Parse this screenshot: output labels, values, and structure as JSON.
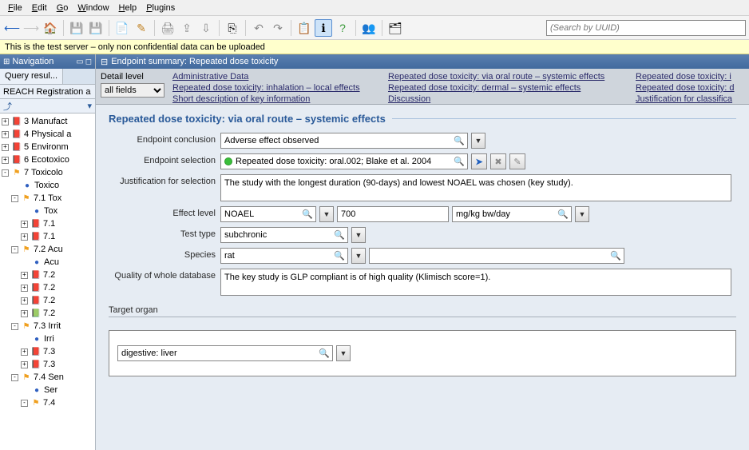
{
  "menubar": [
    {
      "label": "File",
      "ul": "F"
    },
    {
      "label": "Edit",
      "ul": "E"
    },
    {
      "label": "Go",
      "ul": "G"
    },
    {
      "label": "Window",
      "ul": "W"
    },
    {
      "label": "Help",
      "ul": "H"
    },
    {
      "label": "Plugins",
      "ul": "P"
    }
  ],
  "toolbar": {
    "search_placeholder": "(Search by UUID)"
  },
  "banner": "This is the test server – only non confidential data can be uploaded",
  "nav": {
    "title": "Navigation",
    "query_tab": "Query resul...",
    "reach_label": "REACH Registration a",
    "tree": [
      {
        "exp": "+",
        "pad": 0,
        "icon": "book",
        "label": "3 Manufact"
      },
      {
        "exp": "+",
        "pad": 0,
        "icon": "book",
        "label": "4 Physical a"
      },
      {
        "exp": "+",
        "pad": 0,
        "icon": "book",
        "label": "5 Environm"
      },
      {
        "exp": "+",
        "pad": 0,
        "icon": "book",
        "label": "6 Ecotoxico"
      },
      {
        "exp": "-",
        "pad": 0,
        "icon": "flag",
        "label": "7 Toxicolo"
      },
      {
        "exp": "",
        "pad": 1,
        "icon": "ball",
        "label": "Toxico"
      },
      {
        "exp": "-",
        "pad": 1,
        "icon": "flag",
        "label": "7.1 Tox"
      },
      {
        "exp": "",
        "pad": 2,
        "icon": "ball",
        "label": "Tox"
      },
      {
        "exp": "+",
        "pad": 2,
        "icon": "book",
        "label": "7.1"
      },
      {
        "exp": "+",
        "pad": 2,
        "icon": "book",
        "label": "7.1"
      },
      {
        "exp": "-",
        "pad": 1,
        "icon": "flag",
        "label": "7.2 Acu"
      },
      {
        "exp": "",
        "pad": 2,
        "icon": "ball",
        "label": "Acu"
      },
      {
        "exp": "+",
        "pad": 2,
        "icon": "book",
        "label": "7.2"
      },
      {
        "exp": "+",
        "pad": 2,
        "icon": "book",
        "label": "7.2"
      },
      {
        "exp": "+",
        "pad": 2,
        "icon": "book",
        "label": "7.2"
      },
      {
        "exp": "+",
        "pad": 2,
        "icon": "bookg",
        "label": "7.2"
      },
      {
        "exp": "-",
        "pad": 1,
        "icon": "flag",
        "label": "7.3 Irrit"
      },
      {
        "exp": "",
        "pad": 2,
        "icon": "ball",
        "label": "Irri"
      },
      {
        "exp": "+",
        "pad": 2,
        "icon": "book",
        "label": "7.3"
      },
      {
        "exp": "+",
        "pad": 2,
        "icon": "book",
        "label": "7.3"
      },
      {
        "exp": "-",
        "pad": 1,
        "icon": "flag",
        "label": "7.4 Sen"
      },
      {
        "exp": "",
        "pad": 2,
        "icon": "ball",
        "label": "Ser"
      },
      {
        "exp": "-",
        "pad": 2,
        "icon": "flag",
        "label": "7.4"
      }
    ]
  },
  "editor": {
    "title": "Endpoint summary: Repeated dose toxicity",
    "detail_label": "Detail level",
    "detail_value": "all fields",
    "links": {
      "r1c1": "Administrative Data",
      "r1c2": "Repeated dose toxicity: via oral route – systemic effects",
      "r1c3": "Repeated dose toxicity: i",
      "r2c1": "Repeated dose toxicity: inhalation – local effects",
      "r2c2": "Repeated dose toxicity: dermal – systemic effects",
      "r2c3": "Repeated dose toxicity: d",
      "r3c1": "Short description of key information",
      "r3c2": "Discussion",
      "r3c3": "Justification for classifica"
    }
  },
  "form": {
    "section_title": "Repeated dose toxicity: via oral route – systemic effects",
    "endpoint_conclusion_label": "Endpoint conclusion",
    "endpoint_conclusion_value": "Adverse effect observed",
    "endpoint_selection_label": "Endpoint selection",
    "endpoint_selection_value": "Repeated dose toxicity: oral.002; Blake et al. 2004",
    "justification_label": "Justification for selection",
    "justification_value": "The study with the longest duration (90-days) and lowest NOAEL was chosen (key study).",
    "effect_level_label": "Effect level",
    "effect_level_value": "NOAEL",
    "effect_level_num": "700",
    "effect_level_unit": "mg/kg bw/day",
    "test_type_label": "Test type",
    "test_type_value": "subchronic",
    "species_label": "Species",
    "species_value": "rat",
    "species_extra": "",
    "quality_label": "Quality of whole database",
    "quality_value": "The key study is GLP compliant is of high quality (Klimisch score=1).",
    "target_organ_label": "Target organ",
    "target_organ_value": "digestive: liver"
  }
}
